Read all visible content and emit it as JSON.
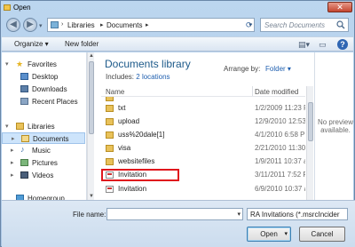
{
  "window": {
    "title": "Open"
  },
  "address": {
    "crumbs": [
      "Libraries",
      "Documents"
    ],
    "search_placeholder": "Search Documents"
  },
  "toolbar": {
    "organize_label": "Organize ▾",
    "new_folder_label": "New folder"
  },
  "navpane": {
    "favorites_label": "Favorites",
    "favorites": [
      "Desktop",
      "Downloads",
      "Recent Places"
    ],
    "libraries_label": "Libraries",
    "libraries": [
      "Documents",
      "Music",
      "Pictures",
      "Videos"
    ],
    "homegroup_label": "Homegroup"
  },
  "library": {
    "title": "Documents library",
    "includes_prefix": "Includes:",
    "includes_link": "2 locations",
    "arrange_label": "Arrange by:",
    "arrange_value": "Folder ▾"
  },
  "columns": {
    "name": "Name",
    "date": "Date modified"
  },
  "files": [
    {
      "name": "txt",
      "date": "1/2/2009 11:23 P",
      "type": "folder"
    },
    {
      "name": "upload",
      "date": "12/9/2010 12:53",
      "type": "folder"
    },
    {
      "name": "uss%20dale[1]",
      "date": "4/1/2010 6:58 PI",
      "type": "folder"
    },
    {
      "name": "visa",
      "date": "2/21/2010 11:30",
      "type": "folder"
    },
    {
      "name": "websitefiles",
      "date": "1/9/2011 10:37 a",
      "type": "folder"
    },
    {
      "name": "Invitation",
      "date": "3/11/2011 7:52 P",
      "type": "doc",
      "highlighted": true
    },
    {
      "name": "Invitation",
      "date": "6/9/2010 10:37 a",
      "type": "doc"
    }
  ],
  "preview": {
    "text": "No preview available."
  },
  "bottom": {
    "filename_label": "File name:",
    "filename_value": "",
    "filter_value": "RA Invitations (*.msrcIncider",
    "open_label": "Open",
    "cancel_label": "Cancel"
  },
  "colors": {
    "highlight": "#e0171d",
    "library_title": "#1d5a8a",
    "link": "#2060b0"
  }
}
